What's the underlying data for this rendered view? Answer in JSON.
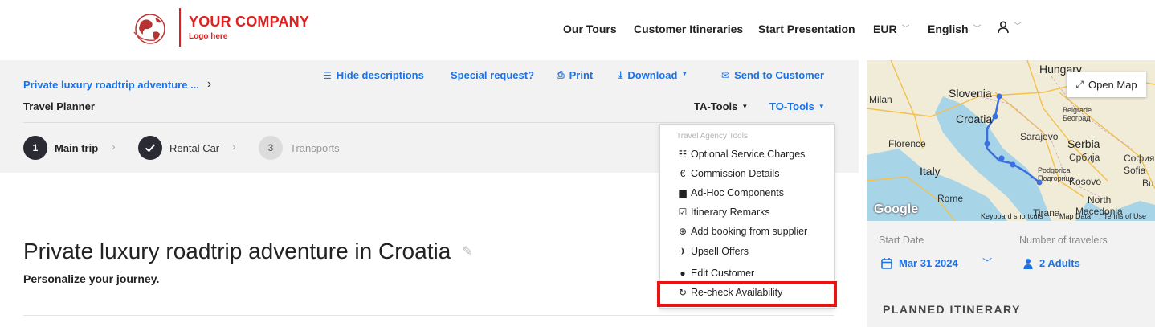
{
  "logo": {
    "name": "YOUR COMPANY",
    "sub": "Logo here",
    "color": "#e02020"
  },
  "topnav": {
    "our_tours": "Our Tours",
    "customer_itineraries": "Customer Itineraries",
    "start_presentation": "Start Presentation",
    "currency": "EUR",
    "language": "English"
  },
  "breadcrumb": {
    "trip": "Private luxury roadtrip adventure ...",
    "page": "Travel Planner"
  },
  "actions": {
    "hide_descriptions": "Hide descriptions",
    "special_request": "Special request?",
    "print": "Print",
    "download": "Download",
    "send_to_customer": "Send to Customer"
  },
  "tools": {
    "ta": "TA-Tools",
    "to": "TO-Tools"
  },
  "steps": [
    {
      "num": "1",
      "label": "Main trip",
      "state": "active"
    },
    {
      "num": "",
      "label": "Rental Car",
      "state": "done"
    },
    {
      "num": "3",
      "label": "Transports",
      "state": "pending"
    }
  ],
  "main": {
    "title": "Private luxury roadtrip adventure in Croatia",
    "subtitle": "Personalize your journey."
  },
  "dropdown": {
    "header": "Travel Agency Tools",
    "items": [
      {
        "label": "Optional Service Charges",
        "icon": "list-icon"
      },
      {
        "label": "Commission Details",
        "icon": "euro-icon"
      },
      {
        "label": "Ad-Hoc Components",
        "icon": "briefcase-icon"
      },
      {
        "label": "Itinerary Remarks",
        "icon": "edit-icon"
      },
      {
        "label": "Add booking from supplier",
        "icon": "add-circle-icon"
      },
      {
        "label": "Upsell Offers",
        "icon": "rocket-icon"
      },
      {
        "label": "Edit Customer",
        "icon": "user-icon"
      },
      {
        "label": "Re-check Availability",
        "icon": "refresh-icon"
      }
    ],
    "highlight_color": "#ee1111"
  },
  "map": {
    "open_map": "Open Map",
    "labels": {
      "hungary": "Hungary",
      "slovenia": "Slovenia",
      "milan": "Milan",
      "croatia": "Croatia",
      "belgrade": "Belgrade",
      "belgrade_cyr": "Београд",
      "sarajevo": "Sarajevo",
      "florence": "Florence",
      "serbia": "Serbia",
      "serbia_cyr": "Србија",
      "italy": "Italy",
      "podgorica": "Podgorica",
      "podgorica_cyr": "Подгорица",
      "kosovo": "Kosovo",
      "sofia": "София",
      "sofia_lat": "Sofia",
      "rome": "Rome",
      "north_macedonia": "North",
      "macedonia": "Macedonia",
      "tirana": "Tirana",
      "bu": "Bu"
    },
    "google": "Google",
    "keyboard": "Keyboard shortcuts",
    "map_data": "Map Data",
    "terms": "Terms of Use"
  },
  "sidebar": {
    "start_date_label": "Start Date",
    "start_date": "Mar 31 2024",
    "travelers_label": "Number of travelers",
    "travelers": "2 Adults",
    "planned": "PLANNED ITINERARY"
  }
}
